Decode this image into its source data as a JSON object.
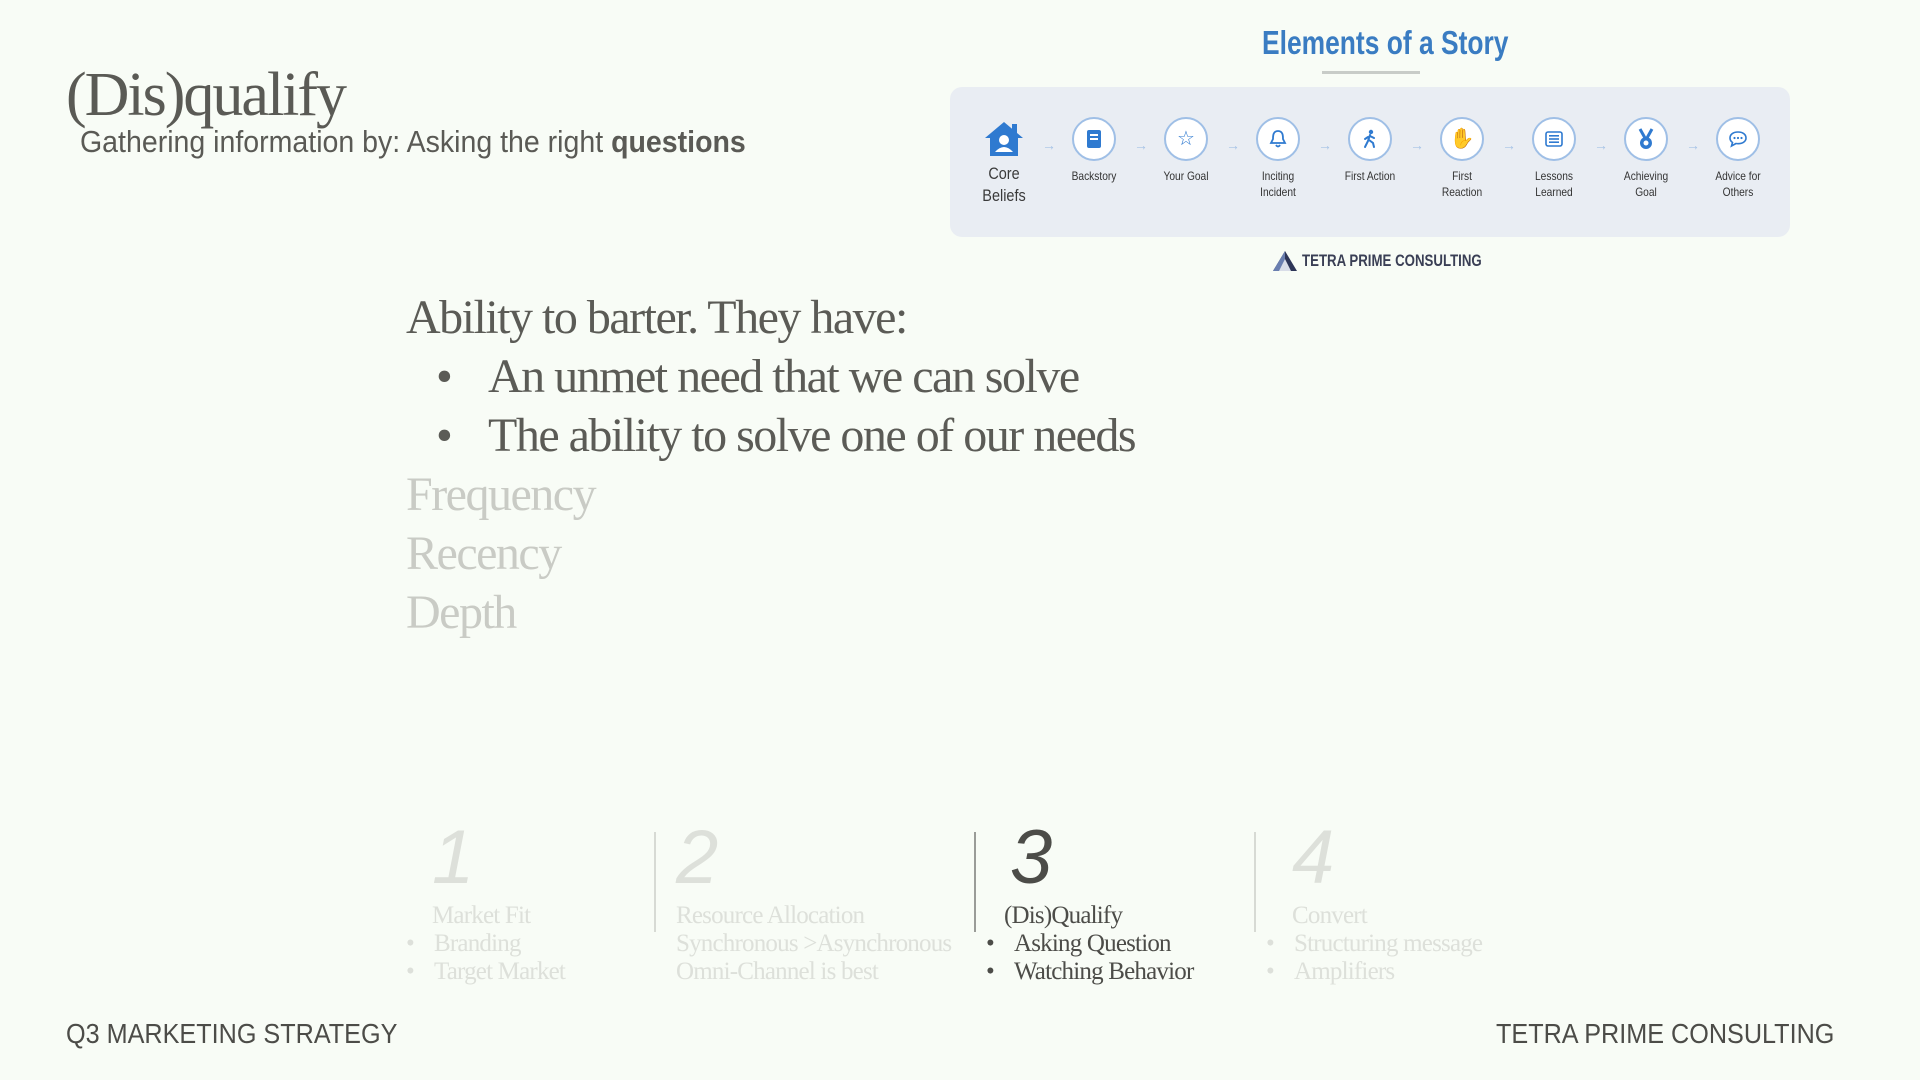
{
  "header": {
    "title": "(Dis)qualify",
    "subtitle_prefix": "Gathering information by: Asking the right ",
    "subtitle_bold": "questions"
  },
  "story": {
    "title": "Elements of a Story",
    "steps": [
      {
        "icon": "home-icon",
        "label": "Core\nBeliefs"
      },
      {
        "icon": "book-icon",
        "label": "Backstory"
      },
      {
        "icon": "star-icon",
        "label": "Your Goal"
      },
      {
        "icon": "bell-icon",
        "label": "Inciting\nIncident"
      },
      {
        "icon": "walking-person-icon",
        "label": "First Action"
      },
      {
        "icon": "hand-icon",
        "label": "First\nReaction"
      },
      {
        "icon": "list-icon",
        "label": "Lessons\nLearned"
      },
      {
        "icon": "medal-icon",
        "label": "Achieving\nGoal"
      },
      {
        "icon": "chat-bubble-icon",
        "label": "Advice for\nOthers"
      }
    ],
    "brand": "TETRA PRIME CONSULTING"
  },
  "main": {
    "heading": "Ability to barter. They have:",
    "bullets": [
      "An unmet need that we can solve",
      "The ability to solve one of our needs"
    ],
    "dim_items": [
      "Frequency",
      "Recency",
      "Depth"
    ]
  },
  "stages": [
    {
      "number": "1",
      "name": "Market Fit",
      "items": [
        "Branding",
        "Target Market"
      ],
      "active": false
    },
    {
      "number": "2",
      "name": "Resource Allocation",
      "items": [
        "Synchronous >Asynchronous",
        "Omni-Channel is best"
      ],
      "active": false
    },
    {
      "number": "3",
      "name": "(Dis)Qualify",
      "items": [
        "Asking Question",
        "Watching Behavior"
      ],
      "active": true
    },
    {
      "number": "4",
      "name": "Convert",
      "items": [
        "Structuring message",
        "Amplifiers"
      ],
      "active": false
    }
  ],
  "footer": {
    "left": "Q3 MARKETING STRATEGY",
    "right": "TETRA PRIME CONSULTING"
  }
}
